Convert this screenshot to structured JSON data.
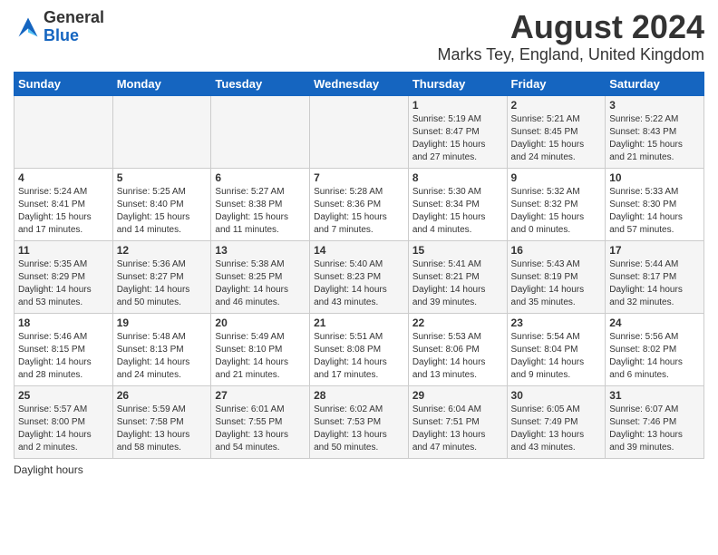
{
  "logo": {
    "general": "General",
    "blue": "Blue"
  },
  "title": "August 2024",
  "subtitle": "Marks Tey, England, United Kingdom",
  "days_header": [
    "Sunday",
    "Monday",
    "Tuesday",
    "Wednesday",
    "Thursday",
    "Friday",
    "Saturday"
  ],
  "footer": "Daylight hours",
  "weeks": [
    [
      {
        "day": "",
        "info": ""
      },
      {
        "day": "",
        "info": ""
      },
      {
        "day": "",
        "info": ""
      },
      {
        "day": "",
        "info": ""
      },
      {
        "day": "1",
        "info": "Sunrise: 5:19 AM\nSunset: 8:47 PM\nDaylight: 15 hours\nand 27 minutes."
      },
      {
        "day": "2",
        "info": "Sunrise: 5:21 AM\nSunset: 8:45 PM\nDaylight: 15 hours\nand 24 minutes."
      },
      {
        "day": "3",
        "info": "Sunrise: 5:22 AM\nSunset: 8:43 PM\nDaylight: 15 hours\nand 21 minutes."
      }
    ],
    [
      {
        "day": "4",
        "info": "Sunrise: 5:24 AM\nSunset: 8:41 PM\nDaylight: 15 hours\nand 17 minutes."
      },
      {
        "day": "5",
        "info": "Sunrise: 5:25 AM\nSunset: 8:40 PM\nDaylight: 15 hours\nand 14 minutes."
      },
      {
        "day": "6",
        "info": "Sunrise: 5:27 AM\nSunset: 8:38 PM\nDaylight: 15 hours\nand 11 minutes."
      },
      {
        "day": "7",
        "info": "Sunrise: 5:28 AM\nSunset: 8:36 PM\nDaylight: 15 hours\nand 7 minutes."
      },
      {
        "day": "8",
        "info": "Sunrise: 5:30 AM\nSunset: 8:34 PM\nDaylight: 15 hours\nand 4 minutes."
      },
      {
        "day": "9",
        "info": "Sunrise: 5:32 AM\nSunset: 8:32 PM\nDaylight: 15 hours\nand 0 minutes."
      },
      {
        "day": "10",
        "info": "Sunrise: 5:33 AM\nSunset: 8:30 PM\nDaylight: 14 hours\nand 57 minutes."
      }
    ],
    [
      {
        "day": "11",
        "info": "Sunrise: 5:35 AM\nSunset: 8:29 PM\nDaylight: 14 hours\nand 53 minutes."
      },
      {
        "day": "12",
        "info": "Sunrise: 5:36 AM\nSunset: 8:27 PM\nDaylight: 14 hours\nand 50 minutes."
      },
      {
        "day": "13",
        "info": "Sunrise: 5:38 AM\nSunset: 8:25 PM\nDaylight: 14 hours\nand 46 minutes."
      },
      {
        "day": "14",
        "info": "Sunrise: 5:40 AM\nSunset: 8:23 PM\nDaylight: 14 hours\nand 43 minutes."
      },
      {
        "day": "15",
        "info": "Sunrise: 5:41 AM\nSunset: 8:21 PM\nDaylight: 14 hours\nand 39 minutes."
      },
      {
        "day": "16",
        "info": "Sunrise: 5:43 AM\nSunset: 8:19 PM\nDaylight: 14 hours\nand 35 minutes."
      },
      {
        "day": "17",
        "info": "Sunrise: 5:44 AM\nSunset: 8:17 PM\nDaylight: 14 hours\nand 32 minutes."
      }
    ],
    [
      {
        "day": "18",
        "info": "Sunrise: 5:46 AM\nSunset: 8:15 PM\nDaylight: 14 hours\nand 28 minutes."
      },
      {
        "day": "19",
        "info": "Sunrise: 5:48 AM\nSunset: 8:13 PM\nDaylight: 14 hours\nand 24 minutes."
      },
      {
        "day": "20",
        "info": "Sunrise: 5:49 AM\nSunset: 8:10 PM\nDaylight: 14 hours\nand 21 minutes."
      },
      {
        "day": "21",
        "info": "Sunrise: 5:51 AM\nSunset: 8:08 PM\nDaylight: 14 hours\nand 17 minutes."
      },
      {
        "day": "22",
        "info": "Sunrise: 5:53 AM\nSunset: 8:06 PM\nDaylight: 14 hours\nand 13 minutes."
      },
      {
        "day": "23",
        "info": "Sunrise: 5:54 AM\nSunset: 8:04 PM\nDaylight: 14 hours\nand 9 minutes."
      },
      {
        "day": "24",
        "info": "Sunrise: 5:56 AM\nSunset: 8:02 PM\nDaylight: 14 hours\nand 6 minutes."
      }
    ],
    [
      {
        "day": "25",
        "info": "Sunrise: 5:57 AM\nSunset: 8:00 PM\nDaylight: 14 hours\nand 2 minutes."
      },
      {
        "day": "26",
        "info": "Sunrise: 5:59 AM\nSunset: 7:58 PM\nDaylight: 13 hours\nand 58 minutes."
      },
      {
        "day": "27",
        "info": "Sunrise: 6:01 AM\nSunset: 7:55 PM\nDaylight: 13 hours\nand 54 minutes."
      },
      {
        "day": "28",
        "info": "Sunrise: 6:02 AM\nSunset: 7:53 PM\nDaylight: 13 hours\nand 50 minutes."
      },
      {
        "day": "29",
        "info": "Sunrise: 6:04 AM\nSunset: 7:51 PM\nDaylight: 13 hours\nand 47 minutes."
      },
      {
        "day": "30",
        "info": "Sunrise: 6:05 AM\nSunset: 7:49 PM\nDaylight: 13 hours\nand 43 minutes."
      },
      {
        "day": "31",
        "info": "Sunrise: 6:07 AM\nSunset: 7:46 PM\nDaylight: 13 hours\nand 39 minutes."
      }
    ]
  ]
}
